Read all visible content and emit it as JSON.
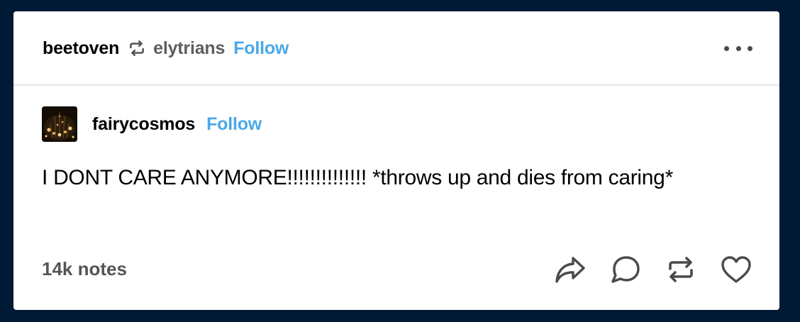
{
  "header": {
    "reblogger": "beetoven",
    "reblog_icon": "reblog-icon",
    "source_user": "elytrians",
    "follow_label": "Follow",
    "more_icon": "more-options-icon"
  },
  "post": {
    "author": "fairycosmos",
    "follow_label": "Follow",
    "body": "I DONT CARE ANYMORE!!!!!!!!!!!!!! *throws up and dies from caring*"
  },
  "footer": {
    "notes": "14k notes",
    "actions": [
      "share-icon",
      "reply-icon",
      "reblog-icon",
      "like-icon"
    ]
  },
  "colors": {
    "background": "#001935",
    "card": "#ffffff",
    "follow": "#4aa8e8",
    "muted": "#555555"
  }
}
